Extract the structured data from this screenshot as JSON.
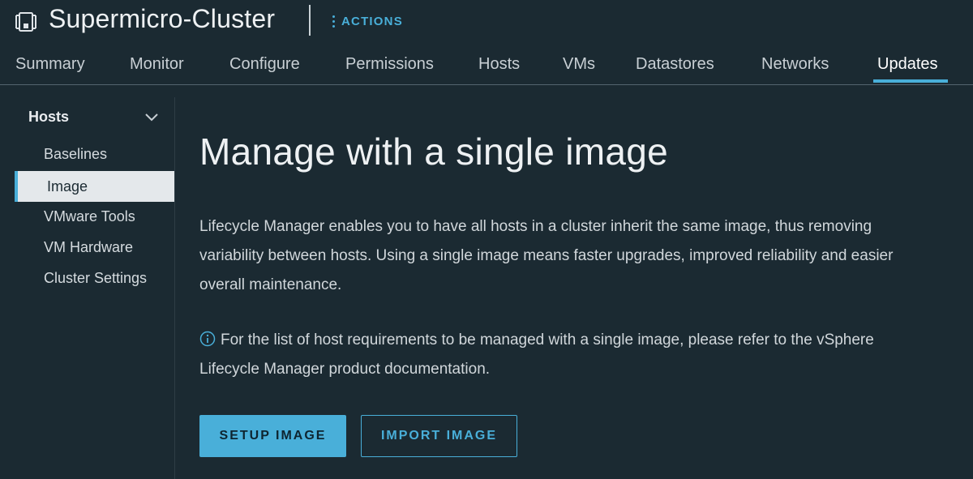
{
  "header": {
    "icon": "cluster-icon",
    "title": "Supermicro-Cluster",
    "actions_label": "ACTIONS"
  },
  "tabs": [
    {
      "label": "Summary"
    },
    {
      "label": "Monitor"
    },
    {
      "label": "Configure"
    },
    {
      "label": "Permissions"
    },
    {
      "label": "Hosts"
    },
    {
      "label": "VMs"
    },
    {
      "label": "Datastores"
    },
    {
      "label": "Networks"
    },
    {
      "label": "Updates",
      "active": true
    }
  ],
  "sidebar": {
    "section": "Hosts",
    "items": [
      {
        "label": "Baselines"
      },
      {
        "label": "Image",
        "active": true
      },
      {
        "label": "VMware Tools"
      },
      {
        "label": "VM Hardware"
      },
      {
        "label": "Cluster Settings"
      }
    ]
  },
  "main": {
    "title": "Manage with a single image",
    "description": "Lifecycle Manager enables you to have all hosts in a cluster inherit the same image, thus removing variability between hosts. Using a single image means faster upgrades, improved reliability and easier overall maintenance.",
    "info_text": "For the list of host requirements to be managed with a single image, please refer to the vSphere Lifecycle Manager product documentation.",
    "setup_button": "SETUP IMAGE",
    "import_button": "IMPORT IMAGE"
  },
  "colors": {
    "background": "#1b2a32",
    "accent": "#49afd9",
    "active_nav_bg": "#e4e8eb"
  }
}
